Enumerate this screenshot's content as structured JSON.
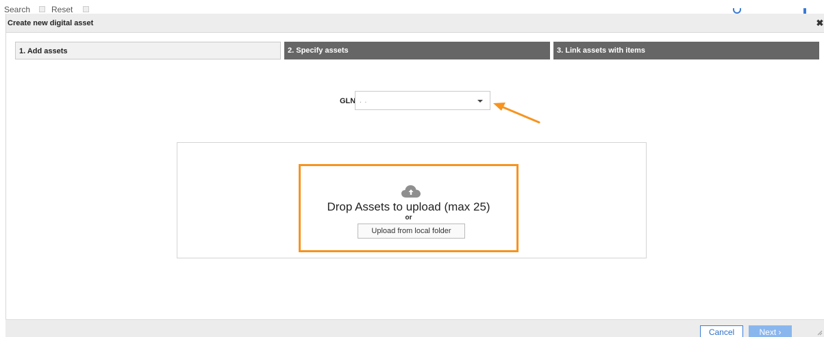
{
  "background": {
    "search_label": "Search",
    "reset_label": "Reset"
  },
  "modal": {
    "title": "Create new digital asset",
    "close_glyph": "✖"
  },
  "steps": [
    {
      "label": "1. Add assets",
      "active": true
    },
    {
      "label": "2. Specify assets",
      "active": false
    },
    {
      "label": "3. Link assets with items",
      "active": false
    }
  ],
  "gln": {
    "label": "GLN",
    "value": ".                .",
    "caret_icon": "chevron-down-icon"
  },
  "upload": {
    "icon": "cloud-upload-icon",
    "drop_text": "Drop Assets to upload (max 25)",
    "or_text": "or",
    "button_label": "Upload from local folder"
  },
  "footer": {
    "cancel_label": "Cancel",
    "next_label": "Next ›"
  },
  "colors": {
    "highlight": "#f7931e",
    "step_inactive": "#666666",
    "primary": "#3a7bd5",
    "next_disabled": "#8ab6ee"
  }
}
